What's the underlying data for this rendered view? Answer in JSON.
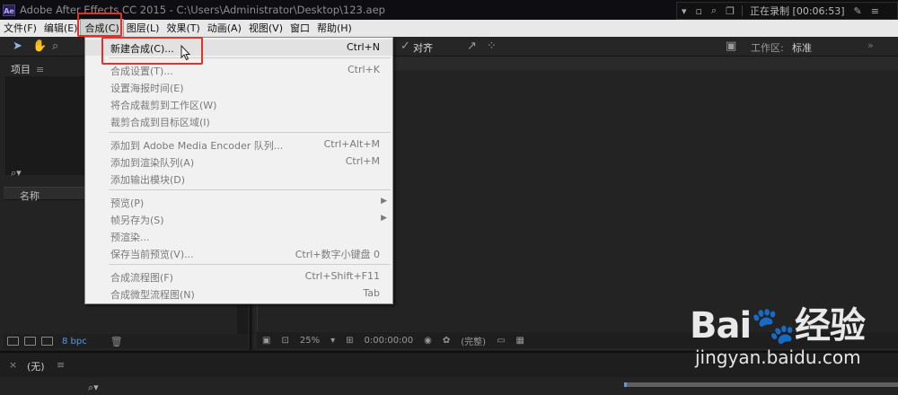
{
  "window": {
    "app_icon": "Ae",
    "title": "Adobe After Effects CC 2015 - C:\\Users\\Administrator\\Desktop\\123.aep"
  },
  "recorder": {
    "status": "正在录制 [00:06:53]"
  },
  "menubar": {
    "items": [
      "文件(F)",
      "编辑(E)",
      "合成(C)",
      "图层(L)",
      "效果(T)",
      "动画(A)",
      "视图(V)",
      "窗口",
      "帮助(H)"
    ],
    "active": "合成(C)"
  },
  "toolbar": {
    "align_label": "对齐",
    "workspace_label": "工作区:",
    "workspace_value": "标准",
    "workspace_sep": "»"
  },
  "project_panel": {
    "title": "项目",
    "column_name": "名称",
    "bpc": "8 bpc"
  },
  "comp_footer": {
    "zoom": "25%",
    "timecode": "0:00:00:00",
    "resolution": "(完整)"
  },
  "timeline": {
    "close": "×",
    "comp_name": "(无)",
    "menu": "≡"
  },
  "comp_menu": {
    "items": [
      {
        "label": "新建合成(C)...",
        "shortcut": "Ctrl+N",
        "enabled": true
      },
      {
        "label": "合成设置(T)...",
        "shortcut": "Ctrl+K",
        "enabled": false
      },
      {
        "label": "设置海报时间(E)",
        "shortcut": "",
        "enabled": false
      },
      {
        "label": "将合成裁剪到工作区(W)",
        "shortcut": "",
        "enabled": false
      },
      {
        "label": "裁剪合成到目标区域(I)",
        "shortcut": "",
        "enabled": false
      },
      {
        "label": "添加到 Adobe Media Encoder 队列...",
        "shortcut": "Ctrl+Alt+M",
        "enabled": false
      },
      {
        "label": "添加到渲染队列(A)",
        "shortcut": "Ctrl+M",
        "enabled": false
      },
      {
        "label": "添加输出模块(D)",
        "shortcut": "",
        "enabled": false
      },
      {
        "label": "预览(P)",
        "shortcut": "",
        "enabled": false,
        "submenu": true
      },
      {
        "label": "帧另存为(S)",
        "shortcut": "",
        "enabled": false,
        "submenu": true
      },
      {
        "label": "预渲染...",
        "shortcut": "",
        "enabled": false
      },
      {
        "label": "保存当前预览(V)...",
        "shortcut": "Ctrl+数字小键盘 0",
        "enabled": false
      },
      {
        "label": "合成流程图(F)",
        "shortcut": "Ctrl+Shift+F11",
        "enabled": false
      },
      {
        "label": "合成微型流程图(N)",
        "shortcut": "Tab",
        "enabled": false
      }
    ]
  },
  "watermark": {
    "logo": "Bai🐾经验",
    "url": "jingyan.baidu.com"
  }
}
